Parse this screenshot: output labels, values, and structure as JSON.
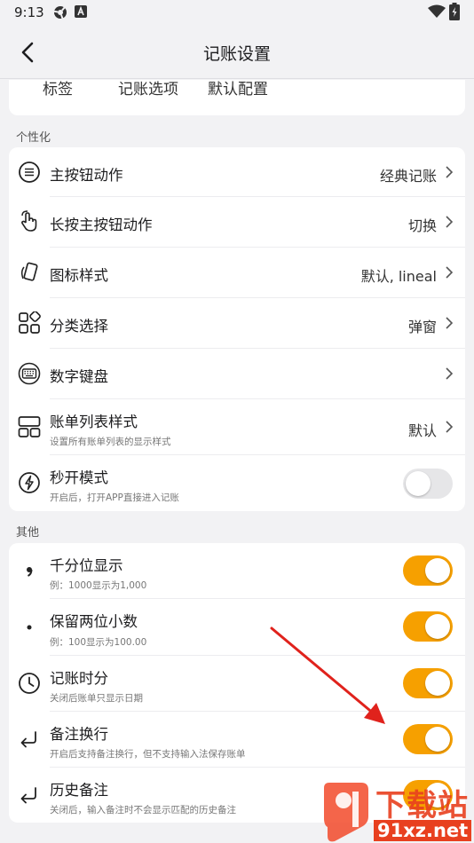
{
  "status_bar": {
    "time": "9:13"
  },
  "header": {
    "title": "记账设置"
  },
  "tabs": [
    "标签",
    "记账选项",
    "默认配置"
  ],
  "personalization": {
    "section_title": "个性化",
    "rows": [
      {
        "label": "主按钮动作",
        "value": "经典记账"
      },
      {
        "label": "长按主按钮动作",
        "value": "切换"
      },
      {
        "label": "图标样式",
        "value": "默认, lineal"
      },
      {
        "label": "分类选择",
        "value": "弹窗"
      },
      {
        "label": "数字键盘",
        "value": ""
      },
      {
        "label": "账单列表样式",
        "sub": "设置所有账单列表的显示样式",
        "value": "默认"
      },
      {
        "label": "秒开模式",
        "sub": "开启后，打开APP直接进入记账",
        "toggle": false
      }
    ]
  },
  "other": {
    "section_title": "其他",
    "rows": [
      {
        "label": "千分位显示",
        "sub": "例：1000显示为1,000",
        "toggle": true
      },
      {
        "label": "保留两位小数",
        "sub": "例：100显示为100.00",
        "toggle": true
      },
      {
        "label": "记账时分",
        "sub": "关闭后账单只显示日期",
        "toggle": true
      },
      {
        "label": "备注换行",
        "sub": "开启后支持备注换行，但不支持输入法保存账单",
        "toggle": true
      },
      {
        "label": "历史备注",
        "sub": "关闭后，输入备注时不会显示匹配的历史备注",
        "toggle": true
      }
    ]
  },
  "watermark": {
    "brand": "下载站",
    "domain": "91xz.net"
  },
  "colors": {
    "accent": "#f6a000",
    "arrow": "#e0221c",
    "background": "#f2f2f4"
  },
  "icons": [
    "android-logo-icon",
    "keyboard-status-icon",
    "wifi-icon",
    "battery-icon",
    "back-arrow-icon",
    "list-circle-icon",
    "touch-hand-icon",
    "phone-tilt-icon",
    "category-grid-icon",
    "keypad-circle-icon",
    "list-layout-icon",
    "lightning-circle-icon",
    "comma-icon",
    "dot-icon",
    "clock-icon",
    "enter-return-icon"
  ]
}
